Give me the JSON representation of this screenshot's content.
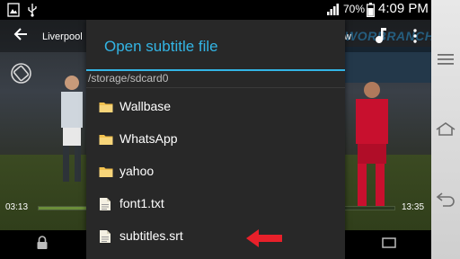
{
  "status_bar": {
    "battery_percent": "70%",
    "time": "4:09 PM",
    "icons": [
      "image-notification-icon",
      "usb-icon",
      "signal-icon",
      "battery-icon"
    ]
  },
  "player": {
    "title": "Liverpool",
    "title_tail": "w",
    "ad_text": "WORBRANCH",
    "elapsed": "03:13",
    "total": "13:35",
    "progress_fraction": 0.24,
    "icons": [
      "back-arrow-icon",
      "music-icon",
      "overflow-menu-icon",
      "rotate-icon",
      "lock-icon",
      "aspect-ratio-icon"
    ]
  },
  "dialog": {
    "title": "Open subtitle file",
    "path": "/storage/sdcard0",
    "items": [
      {
        "name": "Wallbase",
        "type": "folder"
      },
      {
        "name": "WhatsApp",
        "type": "folder"
      },
      {
        "name": "yahoo",
        "type": "folder"
      },
      {
        "name": "font1.txt",
        "type": "file"
      },
      {
        "name": "subtitles.srt",
        "type": "file"
      }
    ]
  },
  "colors": {
    "accent": "#33b5e5",
    "dialog_bg": "#282828",
    "folder": "#f2c14e",
    "annotation_arrow": "#e8202a"
  }
}
